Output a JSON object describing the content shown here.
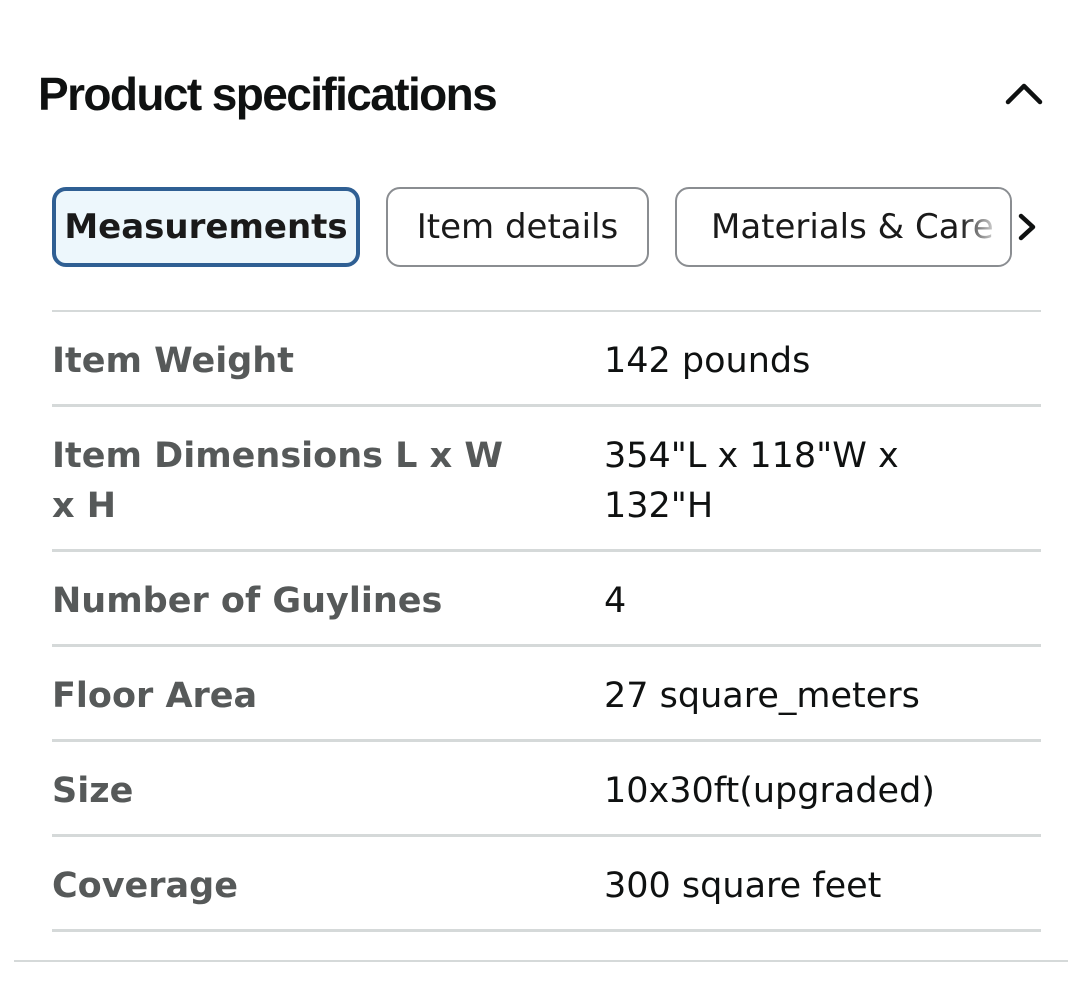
{
  "header": {
    "title": "Product specifications",
    "collapse_icon": "chevron-up-icon"
  },
  "tabs": [
    {
      "label": "Measurements",
      "selected": true
    },
    {
      "label": "Item details",
      "selected": false
    },
    {
      "label": "Materials & Care",
      "selected": false
    }
  ],
  "tabs_next_icon": "chevron-right-icon",
  "specs": [
    {
      "label": "Item Weight",
      "value": "142 pounds"
    },
    {
      "label": "Item Dimensions L x W x H",
      "value": "354\"L x 118\"W x 132\"H"
    },
    {
      "label": "Number of Guylines",
      "value": "4"
    },
    {
      "label": "Floor Area",
      "value": "27 square_meters"
    },
    {
      "label": "Size",
      "value": "10x30ft(upgraded)"
    },
    {
      "label": "Coverage",
      "value": "300 square feet"
    }
  ],
  "colors": {
    "active_tab_border": "#2f5f93",
    "active_tab_background": "#edf7fc",
    "label_text": "#565959",
    "value_text": "#0f1111",
    "divider": "#d5d9d9"
  }
}
